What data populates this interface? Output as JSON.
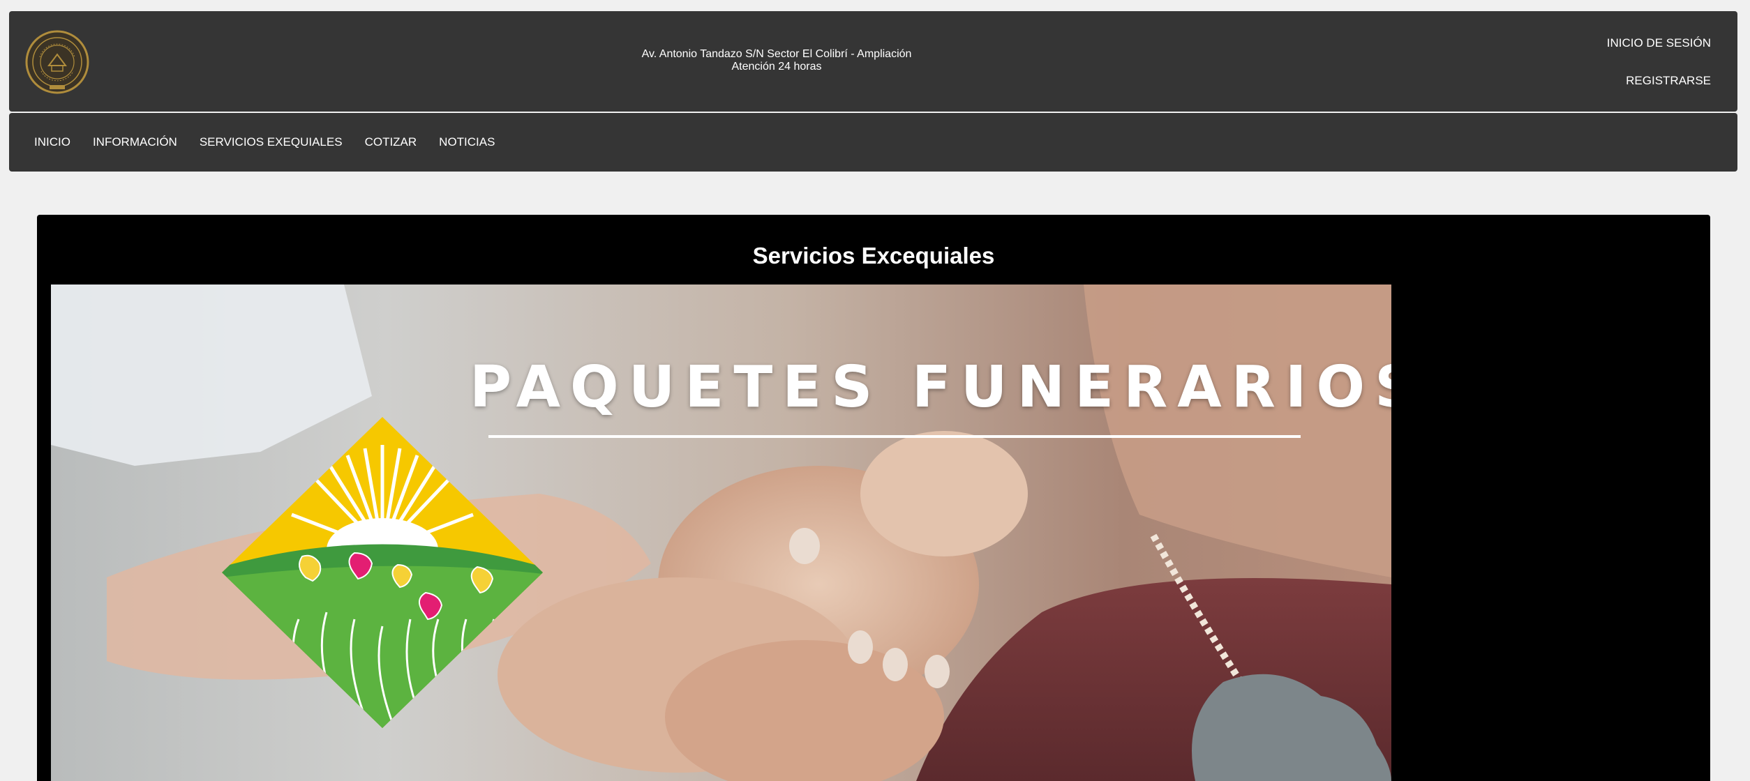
{
  "header": {
    "address_line1": "Av. Antonio Tandazo S/N Sector El Colibrí - Ampliación",
    "address_line2": "Atención 24 horas",
    "login_label": "INICIO DE SESIÓN",
    "register_label": "REGISTRARSE"
  },
  "nav": {
    "items": [
      {
        "label": "INICIO"
      },
      {
        "label": "INFORMACIÓN"
      },
      {
        "label": "SERVICIOS EXEQUIALES"
      },
      {
        "label": "COTIZAR"
      },
      {
        "label": "NOTICIAS"
      }
    ]
  },
  "main": {
    "title": "Servicios Excequiales",
    "banner_heading": "PAQUETES FUNERARIOS"
  },
  "colors": {
    "page_bg": "#f0f0f0",
    "bar_bg": "#353535",
    "panel_bg": "#000000",
    "logo_gold": "#b08d3c",
    "sun_yellow": "#f6c800",
    "field_green": "#4fa33d"
  },
  "icons": {
    "logo": "gold-seal-emblem",
    "banner_logo": "sunrise-flower-field-diamond"
  }
}
